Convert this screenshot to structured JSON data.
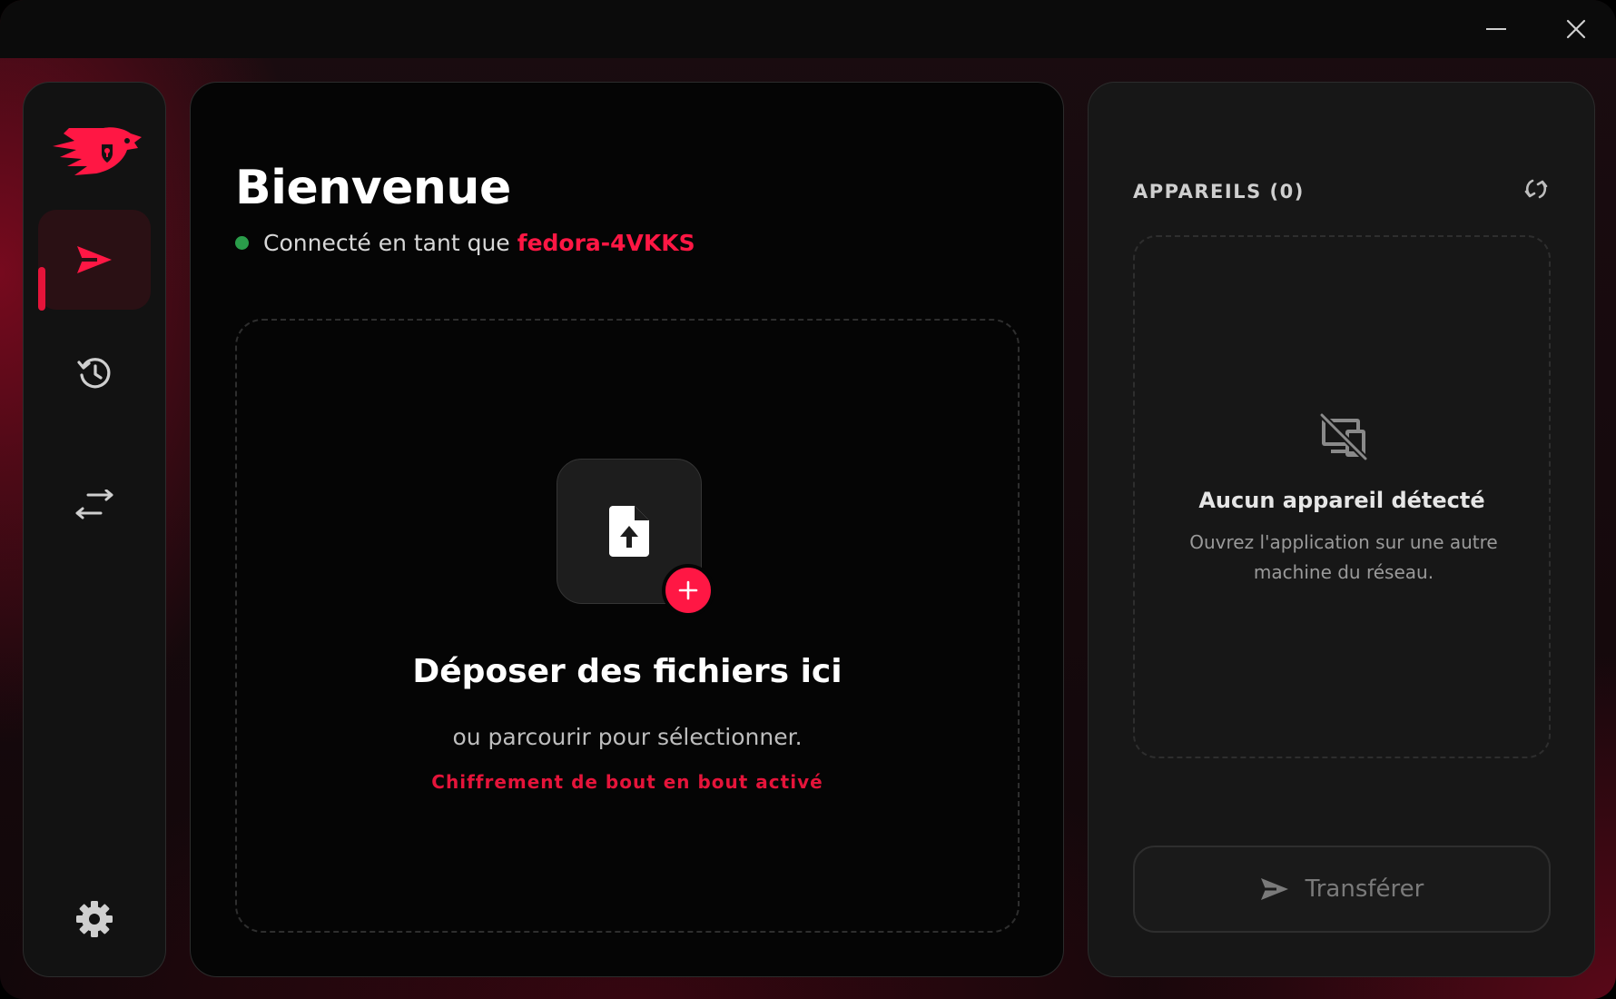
{
  "window": {
    "controls": {
      "minimize_icon": "minimize-icon",
      "close_icon": "close-icon"
    }
  },
  "sidebar": {
    "logo_icon": "eagle-shield-logo",
    "items": [
      {
        "id": "send",
        "icon": "send-arrow-icon",
        "active": true
      },
      {
        "id": "history",
        "icon": "history-icon",
        "active": false
      },
      {
        "id": "transfers",
        "icon": "swap-arrows-icon",
        "active": false
      },
      {
        "id": "settings",
        "icon": "gear-icon",
        "active": false
      }
    ]
  },
  "main": {
    "title": "Bienvenue",
    "status": {
      "prefix": "Connecté en tant que",
      "hostname": "fedora-4VKKS",
      "online_color": "#2a9d4a"
    },
    "dropzone": {
      "icon": "file-upload-icon",
      "add_icon": "plus-icon",
      "title": "Déposer des fichiers ici",
      "subtitle": "ou parcourir pour sélectionner.",
      "encryption_note": "Chiffrement de bout en bout activé"
    }
  },
  "devices": {
    "title": "APPAREILS (0)",
    "refresh_icon": "refresh-icon",
    "empty": {
      "icon": "devices-off-icon",
      "title": "Aucun appareil détecté",
      "description": "Ouvrez l'application sur une autre machine du réseau."
    },
    "transfer_button": {
      "label": "Transférer",
      "icon": "send-arrow-icon",
      "disabled": true
    }
  },
  "colors": {
    "accent": "#ff1744",
    "accent_dark": "#e5143a",
    "panel_bg": "#121212",
    "main_bg": "#050505"
  }
}
